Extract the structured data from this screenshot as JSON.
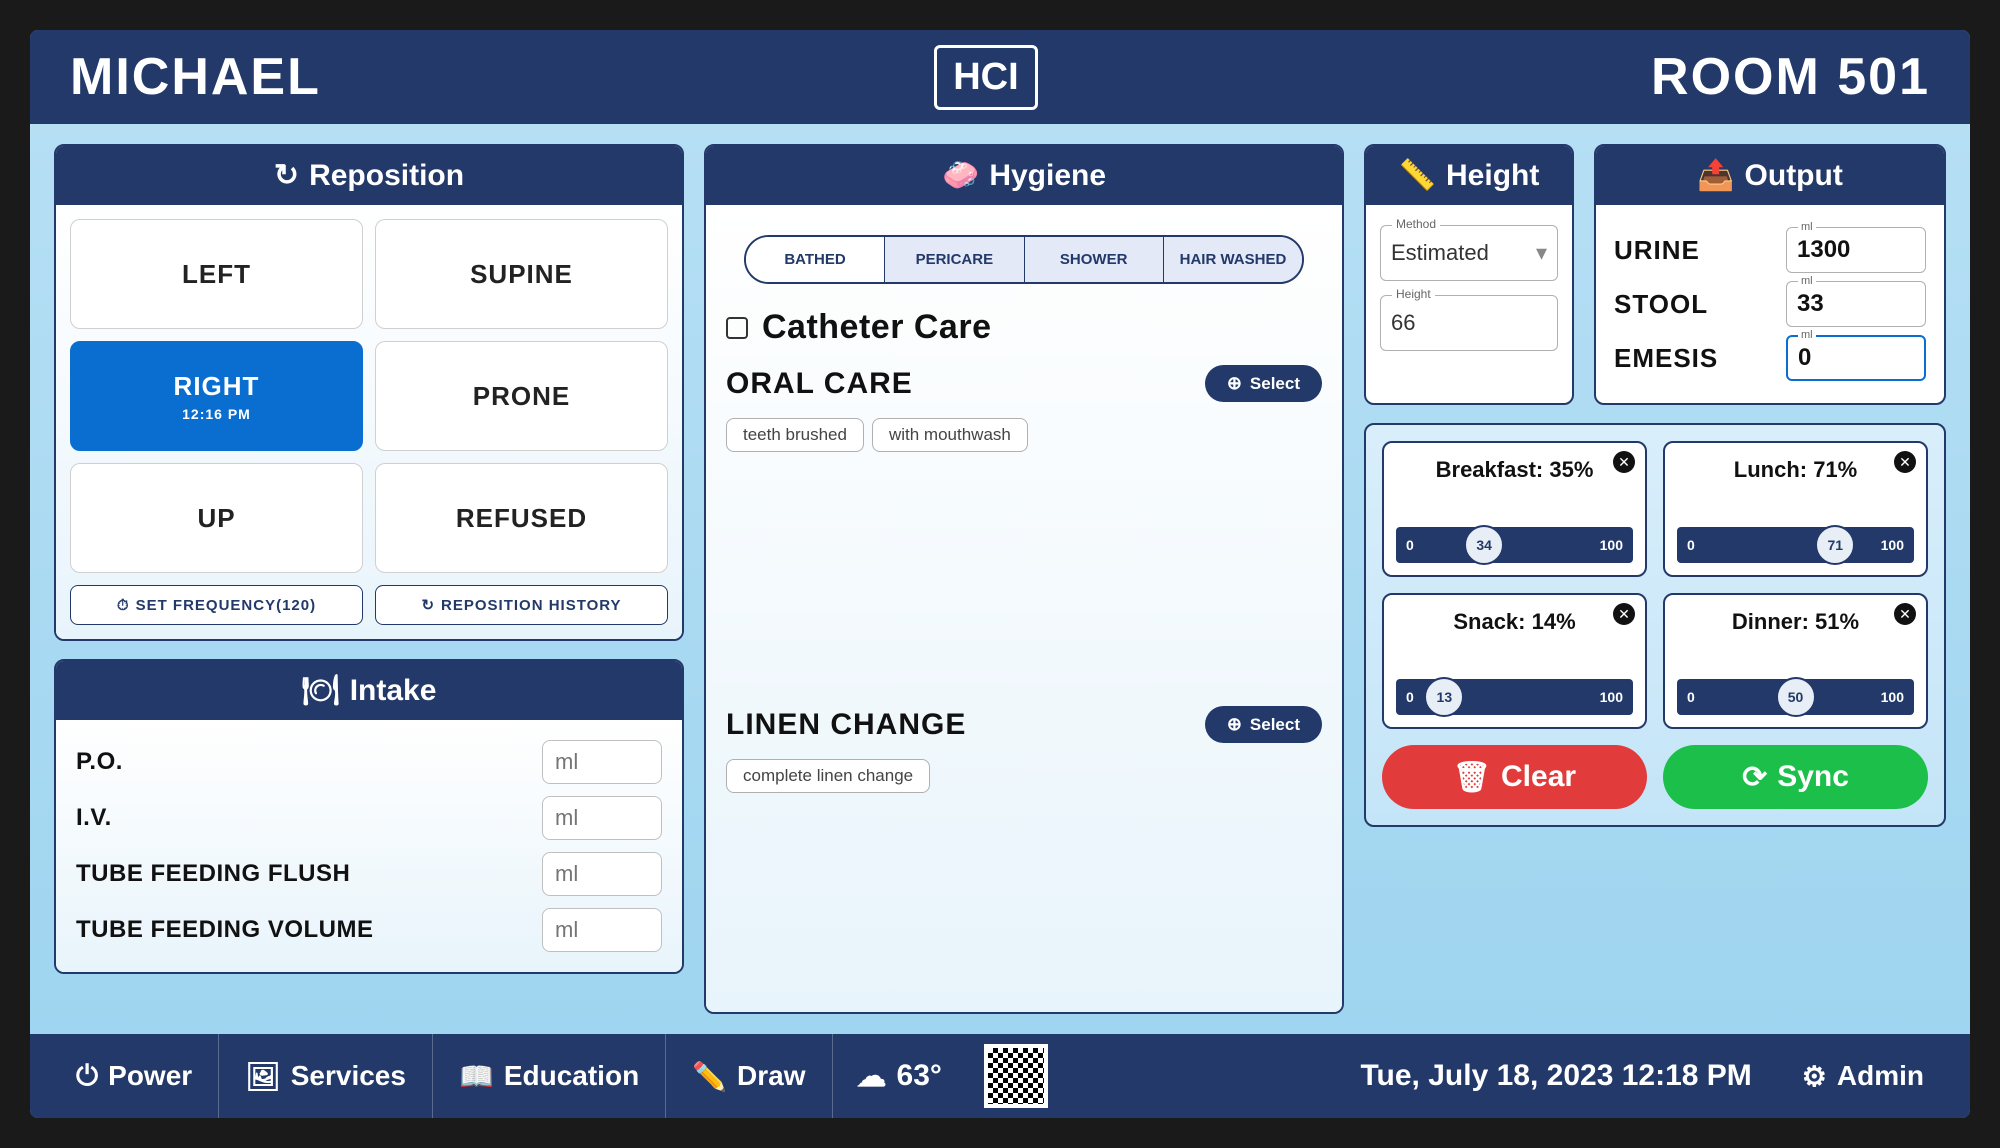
{
  "header": {
    "patient_name": "MICHAEL",
    "logo": "HCI",
    "room": "ROOM 501"
  },
  "reposition": {
    "title": "Reposition",
    "buttons": [
      {
        "label": "LEFT",
        "active": false
      },
      {
        "label": "SUPINE",
        "active": false
      },
      {
        "label": "RIGHT",
        "active": true,
        "time": "12:16 PM"
      },
      {
        "label": "PRONE",
        "active": false
      },
      {
        "label": "UP",
        "active": false
      },
      {
        "label": "REFUSED",
        "active": false
      }
    ],
    "set_frequency": "SET FREQUENCY(120)",
    "history": "REPOSITION HISTORY"
  },
  "intake": {
    "title": "Intake",
    "rows": [
      {
        "label": "P.O.",
        "placeholder": "ml"
      },
      {
        "label": "I.V.",
        "placeholder": "ml"
      },
      {
        "label": "TUBE FEEDING FLUSH",
        "placeholder": "ml"
      },
      {
        "label": "TUBE FEEDING VOLUME",
        "placeholder": "ml"
      }
    ]
  },
  "hygiene": {
    "title": "Hygiene",
    "segments": [
      "BATHED",
      "PERICARE",
      "SHOWER",
      "HAIR WASHED"
    ],
    "active_segment": 0,
    "catheter": "Catheter Care",
    "oral": {
      "title": "ORAL CARE",
      "select": "Select",
      "chips": [
        "teeth brushed",
        "with mouthwash"
      ]
    },
    "linen": {
      "title": "LINEN CHANGE",
      "select": "Select",
      "chips": [
        "complete linen change"
      ]
    }
  },
  "height": {
    "title": "Height",
    "method_label": "Method",
    "method_value": "Estimated",
    "height_label": "Height",
    "height_value": "66"
  },
  "output": {
    "title": "Output",
    "unit": "ml",
    "rows": [
      {
        "label": "URINE",
        "value": "1300"
      },
      {
        "label": "STOOL",
        "value": "33"
      },
      {
        "label": "EMESIS",
        "value": "0",
        "focused": true
      }
    ]
  },
  "meals": {
    "items": [
      {
        "name": "Breakfast",
        "value": 35,
        "knob": 34
      },
      {
        "name": "Lunch",
        "value": 71,
        "knob": 71
      },
      {
        "name": "Snack",
        "value": 14,
        "knob": 13
      },
      {
        "name": "Dinner",
        "value": 51,
        "knob": 50
      }
    ],
    "min": "0",
    "max": "100",
    "clear": "Clear",
    "sync": "Sync"
  },
  "bottombar": {
    "power": "Power",
    "services": "Services",
    "education": "Education",
    "draw": "Draw",
    "temp": "63°",
    "datetime": "Tue, July 18, 2023 12:18 PM",
    "admin": "Admin"
  }
}
